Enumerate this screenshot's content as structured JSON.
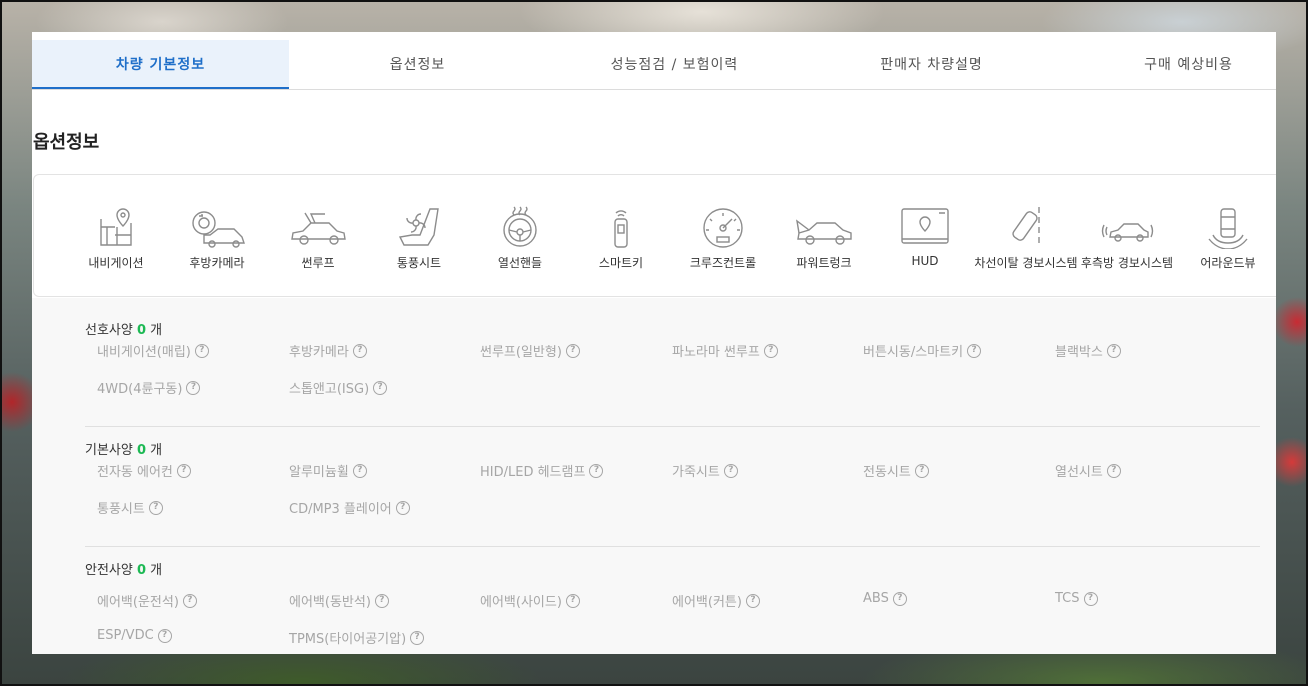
{
  "tabs": [
    {
      "label": "차량 기본정보",
      "active": true
    },
    {
      "label": "옵션정보",
      "active": false
    },
    {
      "label": "성능점검 / 보험이력",
      "active": false
    },
    {
      "label": "판매자 차량설명",
      "active": false
    },
    {
      "label": "구매 예상비용",
      "active": false
    }
  ],
  "section_title": "옵션정보",
  "feature_icons": [
    {
      "label": "내비게이션",
      "icon": "navigation-icon"
    },
    {
      "label": "후방카메라",
      "icon": "rear-camera-icon"
    },
    {
      "label": "썬루프",
      "icon": "sunroof-icon"
    },
    {
      "label": "통풍시트",
      "icon": "ventilated-seat-icon"
    },
    {
      "label": "열선핸들",
      "icon": "heated-steering-icon"
    },
    {
      "label": "스마트키",
      "icon": "smart-key-icon"
    },
    {
      "label": "크루즈컨트롤",
      "icon": "cruise-control-icon"
    },
    {
      "label": "파워트렁크",
      "icon": "power-trunk-icon"
    },
    {
      "label": "HUD",
      "icon": "hud-icon"
    },
    {
      "label": "차선이탈 경보시스템",
      "icon": "lane-departure-icon"
    },
    {
      "label": "후측방 경보시스템",
      "icon": "blind-spot-icon"
    },
    {
      "label": "어라운드뷰",
      "icon": "around-view-icon"
    }
  ],
  "groups": [
    {
      "title": "선호사양",
      "count": "0",
      "unit": "개",
      "options": [
        "내비게이션(매립)",
        "후방카메라",
        "썬루프(일반형)",
        "파노라마 썬루프",
        "버튼시동/스마트키",
        "블랙박스",
        "4WD(4륜구동)",
        "스톱앤고(ISG)"
      ]
    },
    {
      "title": "기본사양",
      "count": "0",
      "unit": "개",
      "options": [
        "전자동 에어컨",
        "알루미늄휠",
        "HID/LED 헤드램프",
        "가죽시트",
        "전동시트",
        "열선시트",
        "통풍시트",
        "CD/MP3 플레이어"
      ]
    },
    {
      "title": "안전사양",
      "count": "0",
      "unit": "개",
      "options": [
        "에어백(운전석)",
        "에어백(동반석)",
        "에어백(사이드)",
        "에어백(커튼)",
        "ABS",
        "TCS",
        "ESP/VDC",
        "TPMS(타이어공기압)"
      ]
    }
  ],
  "help_glyph": "?",
  "colors": {
    "accent": "#1f6fc9",
    "count": "#1db954",
    "muted": "#a6a6a6"
  }
}
